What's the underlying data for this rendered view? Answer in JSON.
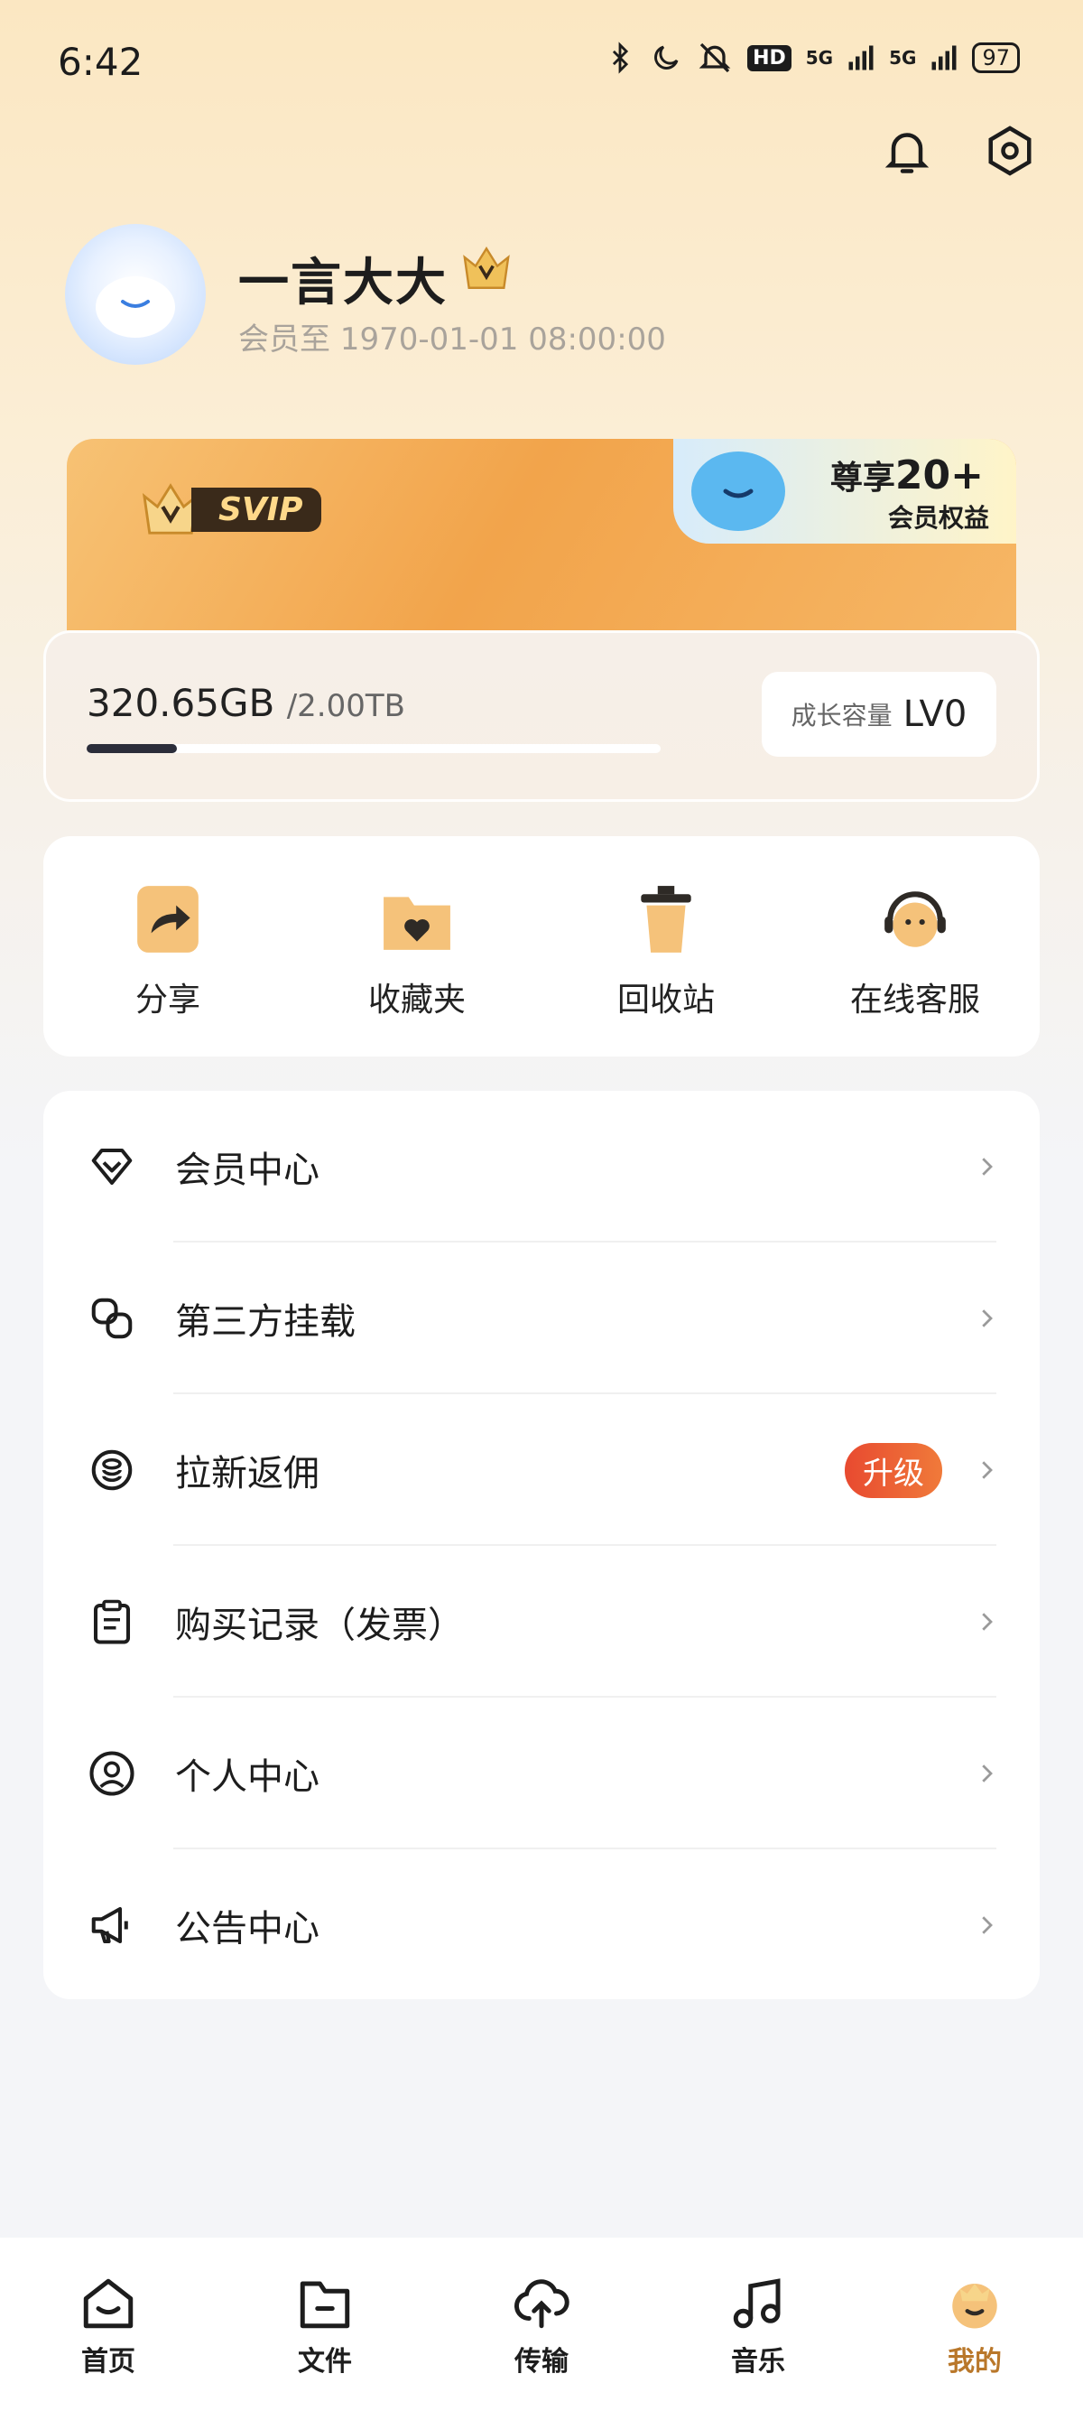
{
  "status_bar": {
    "time": "6:42",
    "hd": "HD",
    "net1": "5G",
    "net2": "5G",
    "battery": "97"
  },
  "profile": {
    "username": "一言大大",
    "member_until": "会员至 1970-01-01 08:00:00"
  },
  "vip_card": {
    "badge": "SVIP",
    "promo_title_prefix": "尊享",
    "promo_title_number": "20+",
    "promo_sub": "会员权益"
  },
  "storage": {
    "used": "320.65GB",
    "total": "/2.00TB",
    "used_fraction": 0.157,
    "growth_label": "成长容量",
    "growth_level": "LV0"
  },
  "quick_actions": [
    {
      "label": "分享",
      "icon": "share-icon"
    },
    {
      "label": "收藏夹",
      "icon": "favorites-folder-icon"
    },
    {
      "label": "回收站",
      "icon": "recycle-bin-icon"
    },
    {
      "label": "在线客服",
      "icon": "customer-service-icon"
    }
  ],
  "menu": [
    {
      "label": "会员中心",
      "icon": "diamond-icon"
    },
    {
      "label": "第三方挂载",
      "icon": "link-icon"
    },
    {
      "label": "拉新返佣",
      "icon": "coin-icon",
      "badge": "升级"
    },
    {
      "label": "购买记录（发票）",
      "icon": "clipboard-icon"
    },
    {
      "label": "个人中心",
      "icon": "user-circle-icon"
    },
    {
      "label": "公告中心",
      "icon": "megaphone-icon"
    }
  ],
  "bottom_nav": [
    {
      "label": "首页",
      "icon": "home-icon"
    },
    {
      "label": "文件",
      "icon": "folder-icon"
    },
    {
      "label": "传输",
      "icon": "upload-cloud-icon"
    },
    {
      "label": "音乐",
      "icon": "music-icon"
    },
    {
      "label": "我的",
      "icon": "profile-avatar-icon",
      "active": true
    }
  ],
  "colors": {
    "accent": "#f2a44b",
    "active_nav": "#b9772a",
    "badge_red": "#e84a30"
  }
}
